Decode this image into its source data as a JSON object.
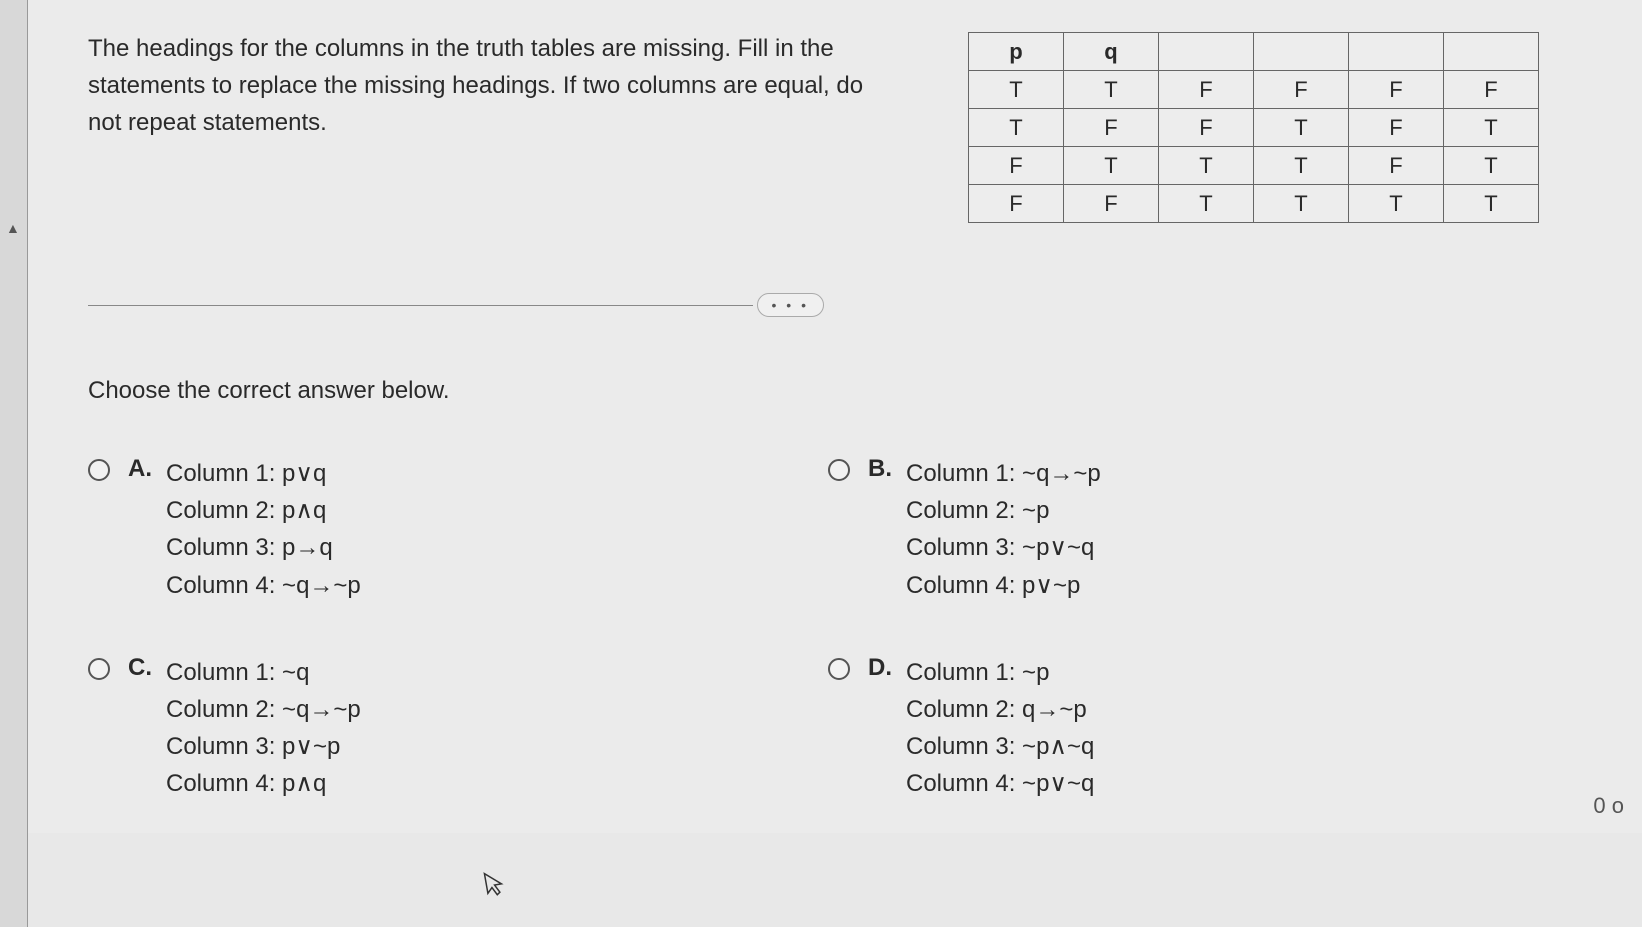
{
  "question": "The headings for the columns in the truth tables are missing. Fill in the statements to replace the missing headings. If two columns are equal, do not repeat statements.",
  "truth_table": {
    "headers": [
      "p",
      "q",
      "",
      "",
      "",
      ""
    ],
    "rows": [
      [
        "T",
        "T",
        "F",
        "F",
        "F",
        "F"
      ],
      [
        "T",
        "F",
        "F",
        "T",
        "F",
        "T"
      ],
      [
        "F",
        "T",
        "T",
        "T",
        "F",
        "T"
      ],
      [
        "F",
        "F",
        "T",
        "T",
        "T",
        "T"
      ]
    ]
  },
  "ellipsis": "• • •",
  "prompt": "Choose the correct answer below.",
  "choices": {
    "A": {
      "letter": "A.",
      "lines": [
        "Column 1: p∨q",
        "Column 2: p∧q",
        "Column 3: p→q",
        "Column 4: ~q→~p"
      ]
    },
    "B": {
      "letter": "B.",
      "lines": [
        "Column 1: ~q→~p",
        "Column 2: ~p",
        "Column 3: ~p∨~q",
        "Column 4: p∨~p"
      ]
    },
    "C": {
      "letter": "C.",
      "lines": [
        "Column 1: ~q",
        "Column 2: ~q→~p",
        "Column 3: p∨~p",
        "Column 4: p∧q"
      ]
    },
    "D": {
      "letter": "D.",
      "lines": [
        "Column 1: ~p",
        "Column 2: q→~p",
        "Column 3: ~p∧~q",
        "Column 4: ~p∨~q"
      ]
    }
  },
  "footer_text": "0 o"
}
